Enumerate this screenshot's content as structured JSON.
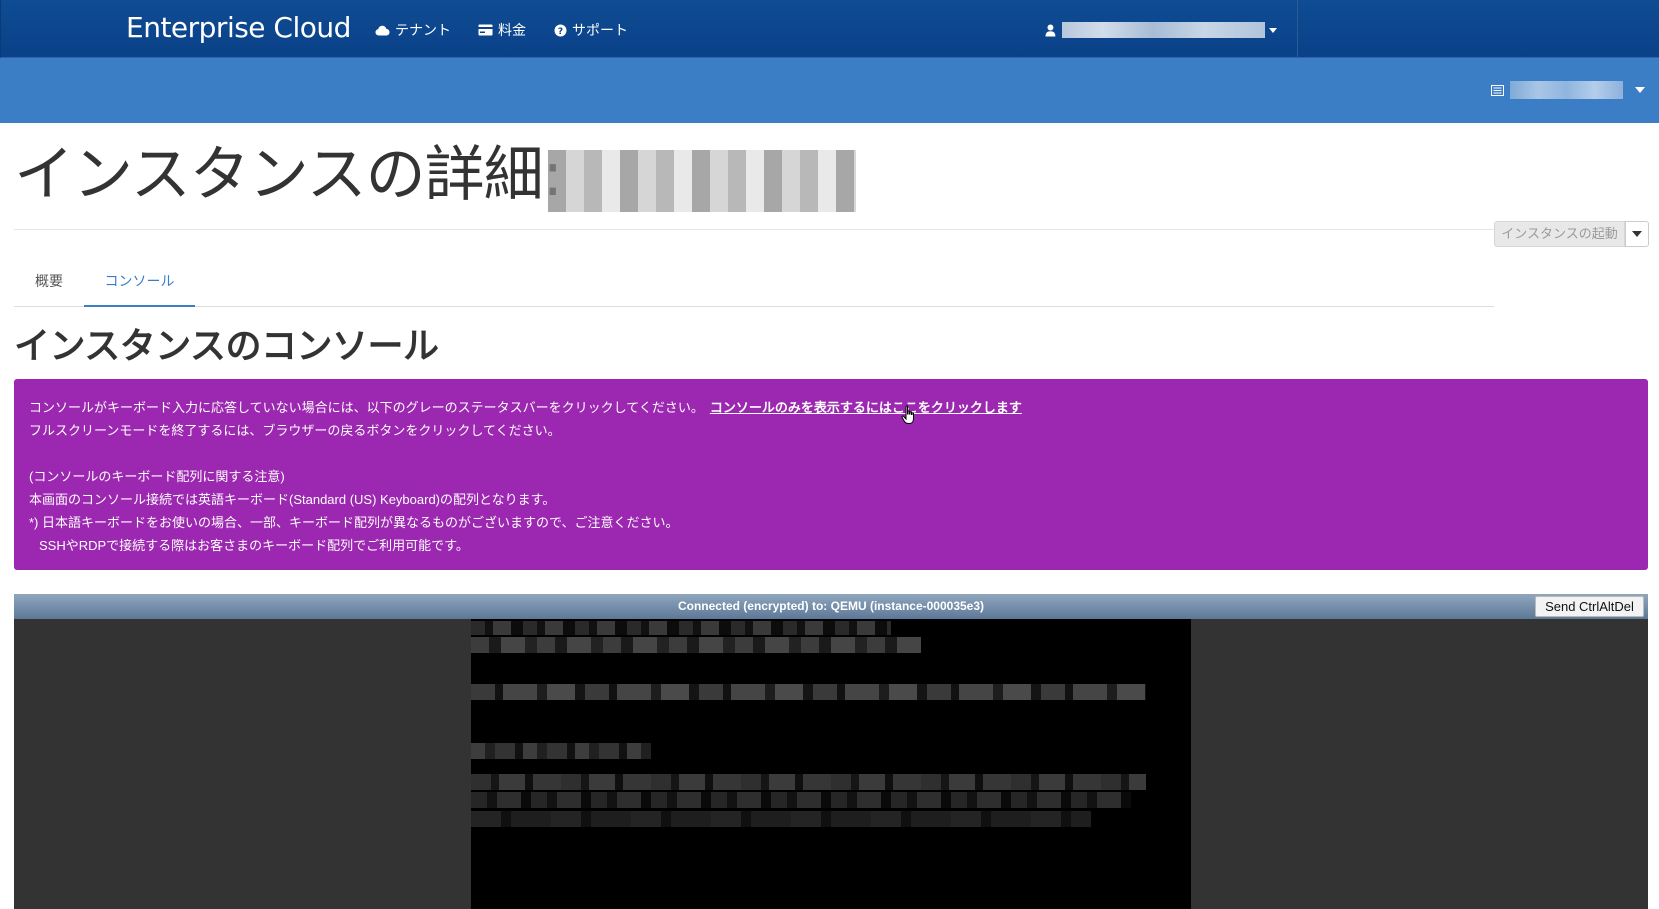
{
  "header": {
    "brand": "Enterprise Cloud",
    "nav": [
      {
        "label": "テナント",
        "icon": "cloud-icon"
      },
      {
        "label": "料金",
        "icon": "credit-card-icon"
      },
      {
        "label": "サポート",
        "icon": "question-circle-icon"
      }
    ],
    "user_icon": "user-icon"
  },
  "subbar": {
    "project_icon": "list-icon"
  },
  "page": {
    "title": "インスタンスの詳細:",
    "launch_button": "インスタンスの起動",
    "tabs": [
      {
        "label": "概要",
        "active": false
      },
      {
        "label": "コンソール",
        "active": true
      }
    ],
    "section_title": "インスタンスのコンソール"
  },
  "alert": {
    "line1": "コンソールがキーボード入力に応答していない場合には、以下のグレーのステータスバーをクリックしてください。",
    "link": "コンソールのみを表示するにはここをクリックします",
    "line2": "フルスクリーンモードを終了するには、ブラウザーの戻るボタンをクリックしてください。",
    "line3": "(コンソールのキーボード配列に関する注意)",
    "line4": "本画面のコンソール接続では英語キーボード(Standard (US) Keyboard)の配列となります。",
    "line5": "*) 日本語キーボードをお使いの場合、一部、キーボード配列が異なるものがございますので、ご注意ください。",
    "line6": "SSHやRDPで接続する際はお客さまのキーボード配列でご利用可能です。",
    "background": "#9c27b0"
  },
  "console": {
    "status": "Connected (encrypted) to: QEMU (instance-000035e3)",
    "ctrl_alt_del": "Send CtrlAltDel"
  },
  "colors": {
    "topbar": "#0a4189",
    "subbar": "#3b7ec6",
    "accent": "#3b7ec6"
  }
}
